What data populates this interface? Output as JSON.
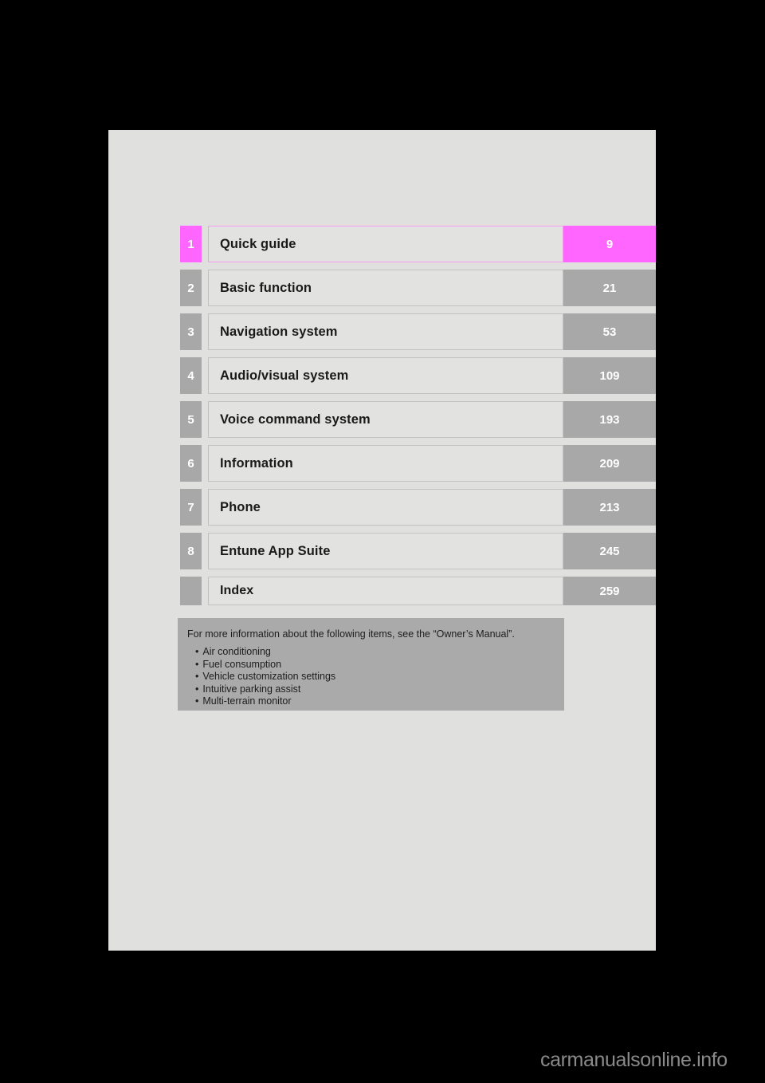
{
  "page": {
    "background_color": "#e0e0df",
    "outer_color": "#000000"
  },
  "chapters": [
    {
      "number": "1",
      "title": "Quick guide",
      "page": "9",
      "current": true
    },
    {
      "number": "2",
      "title": "Basic function",
      "page": "21",
      "current": false
    },
    {
      "number": "3",
      "title": "Navigation system",
      "page": "53",
      "current": false
    },
    {
      "number": "4",
      "title": "Audio/visual system",
      "page": "109",
      "current": false
    },
    {
      "number": "5",
      "title": "Voice command system",
      "page": "193",
      "current": false
    },
    {
      "number": "6",
      "title": "Information",
      "page": "209",
      "current": false
    },
    {
      "number": "7",
      "title": "Phone",
      "page": "213",
      "current": false
    },
    {
      "number": "8",
      "title": "Entune App Suite",
      "page": "245",
      "current": false
    },
    {
      "number": "",
      "title": "Index",
      "page": "259",
      "current": false
    }
  ],
  "notice": {
    "heading": "For more information about the following items, see the “Owner’s Manual”.",
    "items": [
      "Air conditioning",
      "Fuel consumption",
      "Vehicle customization settings",
      "Intuitive parking assist",
      "Multi-terrain monitor"
    ]
  },
  "watermark": {
    "text": "carmanualsonline.info"
  },
  "colors": {
    "accent": "#ff66ff",
    "gray": "#a8a8a8",
    "title_box": "#e2e2e1",
    "notice_box": "#aaaaaa"
  }
}
